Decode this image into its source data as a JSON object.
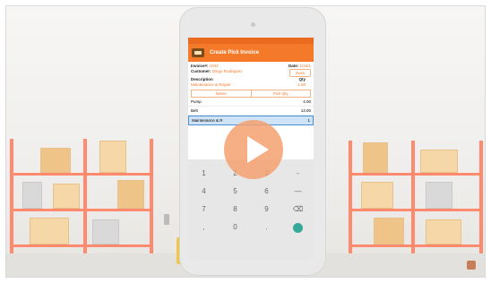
{
  "app": {
    "title": "Create Pick Invoice"
  },
  "invoice": {
    "invoice_label": "Invoice#:",
    "invoice_value": "1042",
    "date_label": "Date:",
    "date_value": "1/15/1",
    "customer_label": "Customer:",
    "customer_value": "Diego Rodriguez",
    "scan_label": "Scan",
    "description_label": "Description",
    "description_value": "Maintenance & Repair",
    "qty_label": "Qty",
    "qty_value": "1.00"
  },
  "table": {
    "headers": [
      "Name",
      "Pick Qty"
    ],
    "rows": [
      {
        "name": "Pump",
        "qty": "4.00"
      },
      {
        "name": "Belt",
        "qty": "13.00"
      },
      {
        "name": "Maintenance & R",
        "qty": "1"
      }
    ]
  },
  "keypad": {
    "keys": [
      "1",
      "2",
      "3",
      "-",
      "4",
      "5",
      "6",
      "—",
      "7",
      "8",
      "9",
      "⌫",
      ",",
      "0",
      ".",
      ""
    ]
  },
  "colors": {
    "brand_orange": "#f47a2a",
    "accent_teal": "#37a99b",
    "play_overlay": "#f5a06e"
  }
}
